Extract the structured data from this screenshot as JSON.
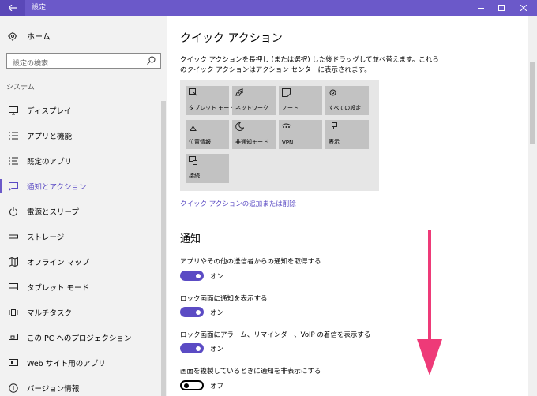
{
  "window": {
    "title": "設定",
    "accent": "#6b59c9"
  },
  "sidebar": {
    "home_label": "ホーム",
    "search_placeholder": "設定の検索",
    "section_label": "システム",
    "items": [
      {
        "label": "ディスプレイ",
        "icon": "display-icon"
      },
      {
        "label": "アプリと機能",
        "icon": "apps-list-icon"
      },
      {
        "label": "既定のアプリ",
        "icon": "default-apps-icon"
      },
      {
        "label": "通知とアクション",
        "icon": "notification-icon",
        "active": true
      },
      {
        "label": "電源とスリープ",
        "icon": "power-icon"
      },
      {
        "label": "ストレージ",
        "icon": "storage-icon"
      },
      {
        "label": "オフライン マップ",
        "icon": "map-icon"
      },
      {
        "label": "タブレット モード",
        "icon": "tablet-icon"
      },
      {
        "label": "マルチタスク",
        "icon": "multitask-icon"
      },
      {
        "label": "この PC へのプロジェクション",
        "icon": "projection-icon"
      },
      {
        "label": "Web サイト用のアプリ",
        "icon": "web-apps-icon"
      },
      {
        "label": "バージョン情報",
        "icon": "info-icon"
      }
    ]
  },
  "main": {
    "quick_actions": {
      "heading": "クイック アクション",
      "description": "クイック アクションを長押し (または選択) した後ドラッグして並べ替えます。これらのクイック アクションはアクション センターに表示されます。",
      "tiles": [
        {
          "label": "タブレット モード",
          "icon": "tablet-mode-icon"
        },
        {
          "label": "ネットワーク",
          "icon": "network-icon"
        },
        {
          "label": "ノート",
          "icon": "note-icon"
        },
        {
          "label": "すべての設定",
          "icon": "gear-icon"
        },
        {
          "label": "位置情報",
          "icon": "location-icon"
        },
        {
          "label": "非通知モード",
          "icon": "moon-icon"
        },
        {
          "label": "VPN",
          "icon": "vpn-icon"
        },
        {
          "label": "表示",
          "icon": "project-icon"
        },
        {
          "label": "接続",
          "icon": "connect-icon"
        }
      ],
      "link": "クイック アクションの追加または削除"
    },
    "notifications": {
      "heading": "通知",
      "settings": [
        {
          "label": "アプリやその他の送信者からの通知を取得する",
          "state": "オン",
          "on": true
        },
        {
          "label": "ロック画面に通知を表示する",
          "state": "オン",
          "on": true
        },
        {
          "label": "ロック画面にアラーム、リマインダー、VoIP の着信を表示する",
          "state": "オン",
          "on": true
        },
        {
          "label": "画面を複製しているときに通知を非表示にする",
          "state": "オフ",
          "on": false
        }
      ]
    }
  },
  "annotation": {
    "arrow_color": "#ee3a78"
  }
}
